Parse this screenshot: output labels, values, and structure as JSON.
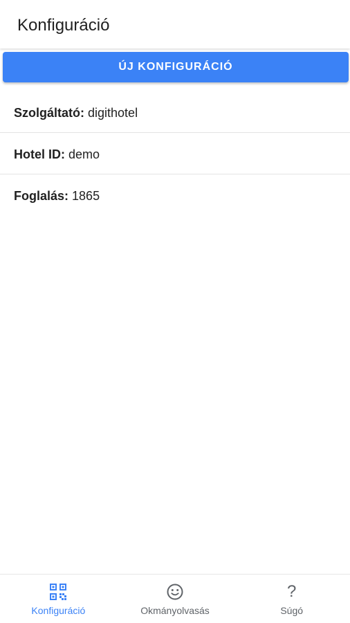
{
  "header": {
    "title": "Konfiguráció"
  },
  "actions": {
    "new_config_label": "ÚJ KONFIGURÁCIÓ"
  },
  "info": {
    "provider_label": "Szolgáltató:",
    "provider_value": "digithotel",
    "hotel_label": "Hotel ID:",
    "hotel_value": "demo",
    "booking_label": "Foglalás:",
    "booking_value": "1865"
  },
  "nav": {
    "items": [
      {
        "label": "Konfiguráció",
        "icon": "qr-code-icon",
        "active": true
      },
      {
        "label": "Okmányolvasás",
        "icon": "smiley-icon",
        "active": false
      },
      {
        "label": "Súgó",
        "icon": "help-icon",
        "active": false
      }
    ]
  },
  "colors": {
    "accent": "#3b82f6",
    "text": "#212121",
    "nav_inactive": "#5f6368"
  }
}
